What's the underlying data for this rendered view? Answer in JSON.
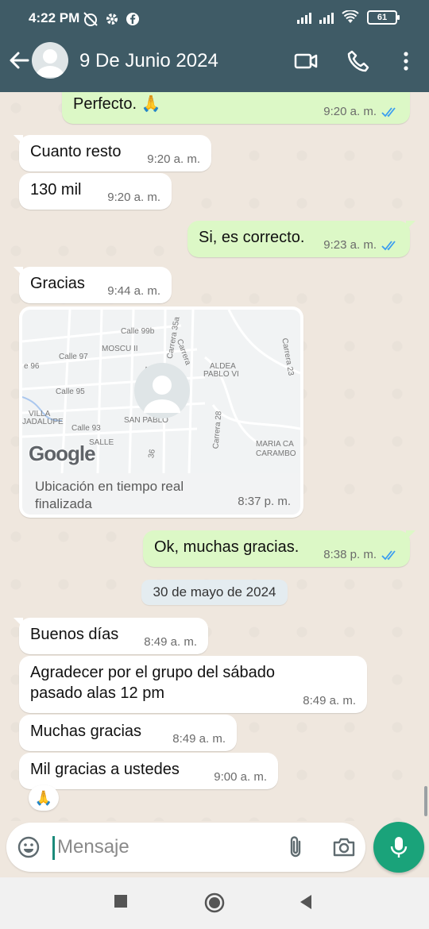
{
  "status_bar": {
    "time": "4:22 PM",
    "battery": "61"
  },
  "header": {
    "title": "9 De Junio 2024"
  },
  "messages": [
    {
      "dir": "out",
      "text": "Perfecto. 🙏",
      "time": "9:20 a. m."
    },
    {
      "dir": "in",
      "text": "Cuanto resto",
      "time": "9:20 a. m."
    },
    {
      "dir": "in",
      "text": "130 mil",
      "time": "9:20 a. m."
    },
    {
      "dir": "out",
      "text": "Si, es correcto.",
      "time": "9:23 a. m."
    },
    {
      "dir": "in",
      "text": "Gracias",
      "time": "9:44 a. m."
    },
    {
      "dir": "out",
      "text": "Ok, muchas gracias.",
      "time": "8:38 p. m."
    },
    {
      "dir": "in",
      "text": "Buenos días",
      "time": "8:49 a. m."
    },
    {
      "dir": "in",
      "text": "Agradecer por el grupo del sábado pasado alas 12 pm",
      "time": "8:49 a. m."
    },
    {
      "dir": "in",
      "text": "Muchas gracias",
      "time": "8:49 a. m."
    },
    {
      "dir": "in",
      "text": "Mil gracias a ustedes",
      "time": "9:00 a. m.",
      "reaction": "🙏"
    }
  ],
  "location": {
    "caption": "Ubicación en tiempo real finalizada",
    "time": "8:37 p. m.",
    "map_labels": [
      "Calle 99b",
      "MOSCU II",
      "Calle 97",
      "e 96",
      "Carrera 37",
      "Carrera 35a",
      "Carrera",
      "ALDEA",
      "PABLO VI",
      "Carrera 23",
      "Calle 95",
      "VILLA",
      "JADALUPE",
      "Calle 93",
      "SAN PABLO",
      "SALLE",
      "Carrera 28",
      "MARIA CA",
      "CARAMBO",
      "36"
    ],
    "brand": "Google"
  },
  "date_divider": "30 de mayo de 2024",
  "composer": {
    "placeholder": "Mensaje"
  },
  "colors": {
    "header": "#3f5b66",
    "outgoing": "#dcf8c6",
    "incoming": "#ffffff",
    "accent": "#1aa37a"
  }
}
